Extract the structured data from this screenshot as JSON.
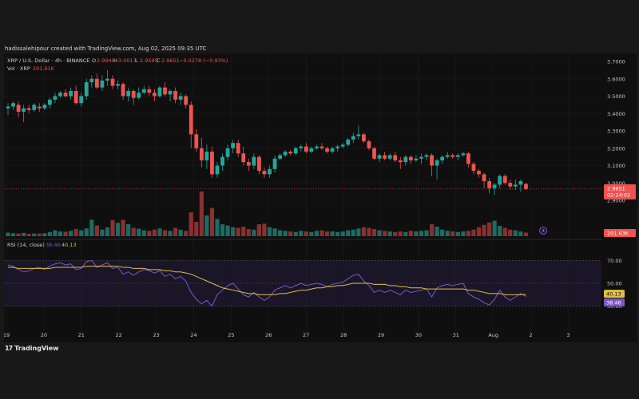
{
  "header": "hadissalehipour created with TradingView.com, Aug 02, 2025 09:35 UTC",
  "brand": "TradingView",
  "brand_logo": "17",
  "colors": {
    "up": "#26a69a",
    "down": "#ef5350",
    "rsi": "#7e57c2",
    "rsi_ma": "#e0c040",
    "bg": "#0f0f0f",
    "grid": "#1c1c1c"
  },
  "legend": {
    "symbol": "XRP / U.S. Dollar · 4h · BINANCE",
    "o_label": "O",
    "o": "2.9940",
    "h_label": "H",
    "h": "3.0017",
    "l_label": "L",
    "l": "2.9595",
    "c_label": "C",
    "c": "2.9651",
    "chg": "−0.0278 (−0.93%)",
    "vol_label": "Vol · XRP",
    "vol": "201.61K",
    "rsi_label": "RSI (14, close)",
    "rsi_val": "38.46",
    "rsi_ma_val": "40.13"
  },
  "price_scale": {
    "ticks": [
      "3.7000",
      "3.6000",
      "3.5000",
      "3.4000",
      "3.3000",
      "3.2000",
      "3.1000",
      "3.0000",
      "2.9000"
    ],
    "last_price": "2.9651",
    "countdown": "02:24:02",
    "vol_tag": "201.63K"
  },
  "rsi_scale": {
    "ticks": [
      "70.00",
      "50.00",
      "30.00"
    ],
    "ma_tag": "40.13",
    "rsi_tag": "38.46"
  },
  "time_axis": [
    "19",
    "20",
    "21",
    "22",
    "23",
    "24",
    "25",
    "26",
    "27",
    "28",
    "29",
    "30",
    "31",
    "Aug",
    "2",
    "3"
  ],
  "chart_data": {
    "type": "candlestick",
    "interval": "4h",
    "price_range": [
      2.87,
      3.72
    ],
    "rsi_range": [
      22,
      78
    ],
    "rsi_levels": [
      70,
      50,
      30
    ],
    "candles": [
      [
        3.43,
        3.46,
        3.39,
        3.44
      ],
      [
        3.44,
        3.47,
        3.42,
        3.46
      ],
      [
        3.45,
        3.47,
        3.38,
        3.41
      ],
      [
        3.41,
        3.45,
        3.35,
        3.43
      ],
      [
        3.43,
        3.45,
        3.4,
        3.42
      ],
      [
        3.42,
        3.46,
        3.41,
        3.45
      ],
      [
        3.44,
        3.46,
        3.41,
        3.43
      ],
      [
        3.43,
        3.46,
        3.42,
        3.45
      ],
      [
        3.45,
        3.49,
        3.43,
        3.48
      ],
      [
        3.48,
        3.52,
        3.46,
        3.5
      ],
      [
        3.5,
        3.53,
        3.49,
        3.52
      ],
      [
        3.52,
        3.54,
        3.49,
        3.5
      ],
      [
        3.5,
        3.55,
        3.48,
        3.53
      ],
      [
        3.53,
        3.56,
        3.45,
        3.46
      ],
      [
        3.46,
        3.52,
        3.44,
        3.5
      ],
      [
        3.5,
        3.6,
        3.48,
        3.58
      ],
      [
        3.58,
        3.62,
        3.55,
        3.6
      ],
      [
        3.6,
        3.63,
        3.54,
        3.55
      ],
      [
        3.55,
        3.62,
        3.53,
        3.59
      ],
      [
        3.59,
        3.65,
        3.56,
        3.6
      ],
      [
        3.6,
        3.62,
        3.54,
        3.56
      ],
      [
        3.56,
        3.59,
        3.54,
        3.57
      ],
      [
        3.57,
        3.58,
        3.48,
        3.5
      ],
      [
        3.5,
        3.55,
        3.47,
        3.53
      ],
      [
        3.53,
        3.54,
        3.45,
        3.49
      ],
      [
        3.49,
        3.55,
        3.48,
        3.52
      ],
      [
        3.52,
        3.56,
        3.51,
        3.54
      ],
      [
        3.54,
        3.56,
        3.5,
        3.52
      ],
      [
        3.52,
        3.54,
        3.47,
        3.5
      ],
      [
        3.5,
        3.56,
        3.49,
        3.55
      ],
      [
        3.55,
        3.58,
        3.5,
        3.51
      ],
      [
        3.51,
        3.54,
        3.47,
        3.53
      ],
      [
        3.53,
        3.55,
        3.46,
        3.48
      ],
      [
        3.48,
        3.52,
        3.45,
        3.5
      ],
      [
        3.5,
        3.51,
        3.43,
        3.45
      ],
      [
        3.45,
        3.47,
        3.2,
        3.28
      ],
      [
        3.28,
        3.31,
        3.18,
        3.2
      ],
      [
        3.2,
        3.26,
        3.09,
        3.13
      ],
      [
        3.13,
        3.22,
        3.08,
        3.18
      ],
      [
        3.18,
        3.21,
        3.03,
        3.05
      ],
      [
        3.05,
        3.12,
        3.03,
        3.1
      ],
      [
        3.1,
        3.17,
        3.07,
        3.15
      ],
      [
        3.15,
        3.22,
        3.13,
        3.2
      ],
      [
        3.2,
        3.25,
        3.17,
        3.23
      ],
      [
        3.23,
        3.25,
        3.15,
        3.17
      ],
      [
        3.17,
        3.21,
        3.1,
        3.12
      ],
      [
        3.12,
        3.14,
        3.07,
        3.1
      ],
      [
        3.1,
        3.17,
        3.08,
        3.15
      ],
      [
        3.15,
        3.16,
        3.05,
        3.07
      ],
      [
        3.07,
        3.09,
        3.03,
        3.05
      ],
      [
        3.05,
        3.1,
        3.03,
        3.08
      ],
      [
        3.08,
        3.16,
        3.06,
        3.14
      ],
      [
        3.14,
        3.17,
        3.13,
        3.16
      ],
      [
        3.16,
        3.19,
        3.15,
        3.18
      ],
      [
        3.18,
        3.19,
        3.16,
        3.17
      ],
      [
        3.17,
        3.21,
        3.16,
        3.2
      ],
      [
        3.2,
        3.22,
        3.18,
        3.21
      ],
      [
        3.21,
        3.23,
        3.17,
        3.18
      ],
      [
        3.18,
        3.21,
        3.17,
        3.2
      ],
      [
        3.2,
        3.22,
        3.19,
        3.21
      ],
      [
        3.21,
        3.23,
        3.19,
        3.2
      ],
      [
        3.2,
        3.21,
        3.17,
        3.18
      ],
      [
        3.18,
        3.21,
        3.17,
        3.2
      ],
      [
        3.2,
        3.22,
        3.18,
        3.21
      ],
      [
        3.21,
        3.23,
        3.2,
        3.22
      ],
      [
        3.22,
        3.26,
        3.21,
        3.25
      ],
      [
        3.25,
        3.29,
        3.23,
        3.27
      ],
      [
        3.27,
        3.33,
        3.25,
        3.28
      ],
      [
        3.28,
        3.29,
        3.23,
        3.24
      ],
      [
        3.24,
        3.25,
        3.19,
        3.2
      ],
      [
        3.2,
        3.21,
        3.13,
        3.14
      ],
      [
        3.14,
        3.17,
        3.12,
        3.16
      ],
      [
        3.16,
        3.18,
        3.13,
        3.14
      ],
      [
        3.14,
        3.17,
        3.13,
        3.16
      ],
      [
        3.16,
        3.18,
        3.12,
        3.13
      ],
      [
        3.13,
        3.15,
        3.08,
        3.12
      ],
      [
        3.12,
        3.16,
        3.1,
        3.15
      ],
      [
        3.15,
        3.16,
        3.11,
        3.13
      ],
      [
        3.13,
        3.16,
        3.12,
        3.14
      ],
      [
        3.14,
        3.17,
        3.11,
        3.15
      ],
      [
        3.15,
        3.17,
        3.13,
        3.16
      ],
      [
        3.16,
        3.17,
        3.04,
        3.1
      ],
      [
        3.1,
        3.14,
        3.02,
        3.13
      ],
      [
        3.13,
        3.16,
        3.11,
        3.15
      ],
      [
        3.15,
        3.18,
        3.14,
        3.16
      ],
      [
        3.16,
        3.17,
        3.14,
        3.15
      ],
      [
        3.15,
        3.17,
        3.13,
        3.16
      ],
      [
        3.16,
        3.18,
        3.15,
        3.17
      ],
      [
        3.17,
        3.18,
        3.09,
        3.11
      ],
      [
        3.11,
        3.12,
        3.05,
        3.07
      ],
      [
        3.07,
        3.08,
        3.03,
        3.05
      ],
      [
        3.05,
        3.06,
        2.97,
        3.01
      ],
      [
        3.01,
        3.03,
        2.94,
        2.97
      ],
      [
        2.97,
        3.0,
        2.93,
        2.99
      ],
      [
        2.99,
        3.05,
        2.97,
        3.04
      ],
      [
        3.04,
        3.05,
        2.99,
        3.0
      ],
      [
        3.0,
        3.02,
        2.96,
        2.98
      ],
      [
        2.98,
        3.02,
        2.96,
        2.99
      ],
      [
        2.99,
        3.02,
        2.95,
        3.01
      ],
      [
        2.994,
        3.0017,
        2.9595,
        2.9651
      ]
    ],
    "volume": [
      12,
      10,
      9,
      11,
      8,
      9,
      9,
      10,
      14,
      20,
      16,
      15,
      18,
      24,
      20,
      26,
      55,
      36,
      22,
      30,
      54,
      45,
      55,
      40,
      28,
      25,
      20,
      18,
      22,
      26,
      20,
      18,
      28,
      22,
      18,
      80,
      48,
      150,
      70,
      95,
      58,
      40,
      36,
      30,
      28,
      32,
      24,
      22,
      40,
      42,
      30,
      26,
      20,
      18,
      16,
      14,
      18,
      16,
      14,
      18,
      20,
      16,
      16,
      14,
      16,
      20,
      22,
      26,
      30,
      28,
      24,
      20,
      18,
      16,
      14,
      16,
      14,
      18,
      16,
      18,
      20,
      40,
      32,
      22,
      18,
      16,
      14,
      16,
      18,
      22,
      30,
      38,
      46,
      52,
      35,
      28,
      22,
      20,
      16,
      12
    ],
    "rsi": [
      66,
      65,
      62,
      60,
      61,
      63,
      64,
      62,
      65,
      67,
      68,
      66,
      67,
      62,
      63,
      69,
      70,
      64,
      66,
      68,
      63,
      64,
      58,
      60,
      57,
      60,
      62,
      61,
      59,
      61,
      56,
      58,
      54,
      56,
      52,
      42,
      36,
      32,
      35,
      30,
      40,
      44,
      48,
      50,
      45,
      40,
      38,
      42,
      38,
      35,
      38,
      44,
      46,
      48,
      46,
      48,
      50,
      48,
      49,
      50,
      49,
      47,
      49,
      50,
      51,
      54,
      57,
      58,
      52,
      48,
      42,
      44,
      42,
      44,
      42,
      40,
      44,
      42,
      43,
      44,
      45,
      38,
      46,
      48,
      49,
      48,
      49,
      50,
      41,
      38,
      36,
      33,
      31,
      36,
      44,
      38,
      35,
      38,
      41,
      38.46
    ],
    "rsi_ma": [
      64,
      64,
      63,
      63,
      63,
      63,
      63,
      63,
      63,
      64,
      64,
      64,
      64,
      64,
      64,
      65,
      65,
      65,
      65,
      65,
      65,
      65,
      64,
      64,
      63,
      63,
      63,
      62,
      62,
      62,
      61,
      61,
      60,
      60,
      59,
      58,
      56,
      54,
      52,
      50,
      48,
      46,
      45,
      44,
      43,
      42,
      41,
      41,
      40,
      40,
      40,
      40,
      41,
      41,
      42,
      43,
      44,
      44,
      45,
      46,
      46,
      47,
      47,
      48,
      48,
      49,
      50,
      50,
      50,
      50,
      49,
      49,
      49,
      48,
      48,
      47,
      47,
      46,
      46,
      46,
      45,
      45,
      45,
      45,
      45,
      45,
      45,
      45,
      44,
      44,
      43,
      42,
      41,
      41,
      41,
      40,
      40,
      40,
      40,
      40.13
    ]
  }
}
